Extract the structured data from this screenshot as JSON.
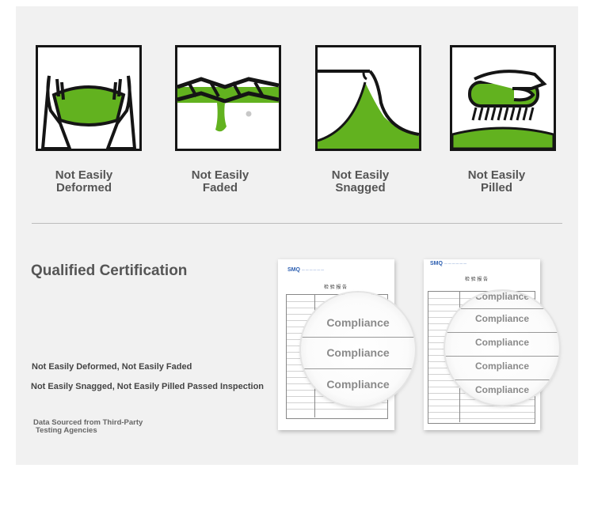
{
  "features": [
    {
      "label_1": "Not Easily",
      "label_2": "Deformed",
      "icon": "stretch-icon"
    },
    {
      "label_1": "Not Easily",
      "label_2": "Faded",
      "icon": "dye-drip-icon"
    },
    {
      "label_1": "Not Easily",
      "label_2": "Snagged",
      "icon": "snag-icon"
    },
    {
      "label_1": "Not Easily",
      "label_2": "Pilled",
      "icon": "brush-icon"
    }
  ],
  "certification": {
    "title": "Qualified Certification",
    "line_1": "Not Easily Deformed, Not Easily Faded",
    "line_2": "Not Easily Snagged, Not Easily Pilled Passed Inspection",
    "source_1": "Data Sourced from Third-Party",
    "source_2": "Testing Agencies"
  },
  "reports": [
    {
      "logo": "SMQ",
      "title": "检 验 报 告",
      "magnifier": [
        "Compliance",
        "Compliance",
        "Compliance"
      ]
    },
    {
      "logo": "SMQ",
      "title": "检 验 报 告",
      "magnifier": [
        "Compliance",
        "Compliance",
        "Compliance",
        "Compliance",
        "Compliance"
      ]
    }
  ],
  "colors": {
    "accent": "#62b21f",
    "ink": "#151515",
    "panel": "#f1f1f1",
    "label": "#555555"
  }
}
